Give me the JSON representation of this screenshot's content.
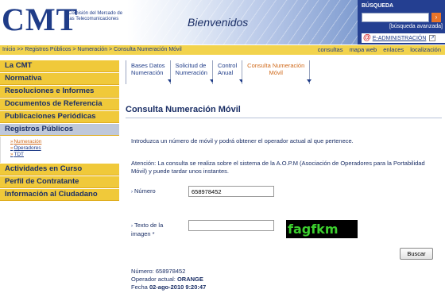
{
  "header": {
    "logo": "CMT",
    "logo_sub": "Comisión del Mercado de las Telecomunicaciones",
    "banner_title": "Bienvenidos",
    "search_label": "BÚSQUEDA",
    "search_placeholder": "",
    "search_go": "›",
    "search_advanced": "[búsqueda avanzada]",
    "eadmin_at": "@",
    "eadmin": "E-ADMINISTRACIÓN",
    "eadmin_icon": "↗"
  },
  "breadcrumb": {
    "text": "Inicio >> Registros Públicos > Numeración > ",
    "current": "Consulta Numeración Móvil"
  },
  "top_links": [
    "consultas",
    "mapa web",
    "enlaces",
    "localización"
  ],
  "sidebar": {
    "items_top": [
      "La CMT",
      "Normativa",
      "Resoluciones e Informes",
      "Documentos de Referencia",
      "Publicaciones Periódicas"
    ],
    "registros": "Registros Públicos",
    "sub_items": [
      {
        "label": "Numeración",
        "active": true
      },
      {
        "label": "Operadores",
        "active": false
      },
      {
        "label": "TDT",
        "active": false
      }
    ],
    "items_bottom": [
      "Actividades en Curso",
      "Perfil de Contratante",
      "Información al Ciudadano"
    ]
  },
  "tabs": [
    {
      "line1": "Bases Datos",
      "line2": "Numeración",
      "active": false
    },
    {
      "line1": "Solicitud de",
      "line2": "Numeración",
      "active": false
    },
    {
      "line1": "Control",
      "line2": "Anual",
      "active": false
    },
    {
      "line1": "Consulta Numeración",
      "line2": "Móvil",
      "active": true
    }
  ],
  "main": {
    "title": "Consulta Numeración Móvil",
    "intro": "Introduzca un número de móvil y podrá obtener el operador actual al que pertenece.",
    "attention": "Atención: La consulta se realiza sobre el sistema de la A.O.P.M (Asociación de Operadores para la Portabilidad Móvil) y puede tardar unos instantes.",
    "numero_label": "Número",
    "numero_value": "658978452",
    "captcha_label": "Texto de la imagen *",
    "captcha_value": "",
    "captcha_text": "fagfkm",
    "search_button": "Buscar"
  },
  "result": {
    "numero_label": "Número:",
    "numero": "658978452",
    "operador_label": "Operador actual:",
    "operador": "ORANGE",
    "fecha_label": "Fecha",
    "fecha": "02-ago-2010 9:20:47"
  },
  "colors": {
    "accent_yellow": "#f0c93a",
    "brand_blue": "#1f3c88",
    "active_orange": "#d06a1b",
    "captcha_green": "#3ccf2e"
  }
}
